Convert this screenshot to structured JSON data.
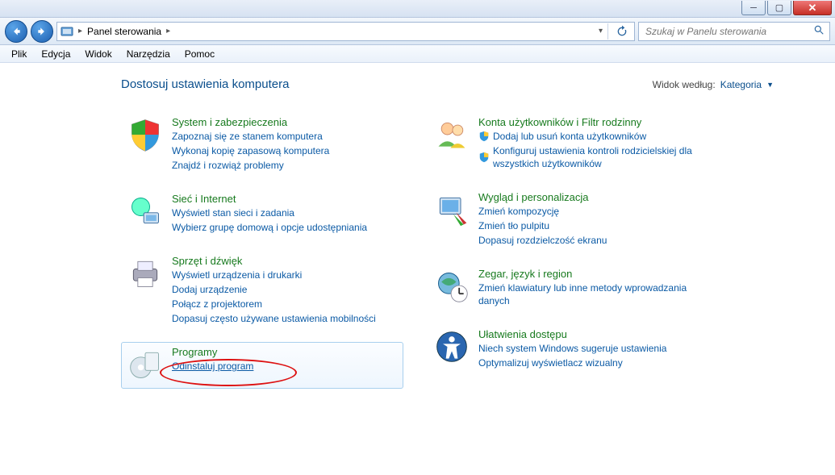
{
  "sysbuttons": {
    "min_tip": "Minimize",
    "max_tip": "Maximize",
    "close_tip": "Close"
  },
  "breadcrumb": {
    "root": "Panel sterowania"
  },
  "search": {
    "placeholder": "Szukaj w Panelu sterowania"
  },
  "menu": {
    "file": "Plik",
    "edit": "Edycja",
    "view": "Widok",
    "tools": "Narzędzia",
    "help": "Pomoc"
  },
  "header": {
    "title": "Dostosuj ustawienia komputera",
    "viewby_label": "Widok według:",
    "viewby_value": "Kategoria"
  },
  "cats": {
    "system": {
      "title": "System i zabezpieczenia",
      "l1": "Zapoznaj się ze stanem komputera",
      "l2": "Wykonaj kopię zapasową komputera",
      "l3": "Znajdź i rozwiąż problemy"
    },
    "network": {
      "title": "Sieć i Internet",
      "l1": "Wyświetl stan sieci i zadania",
      "l2": "Wybierz grupę domową i opcje udostępniania"
    },
    "hardware": {
      "title": "Sprzęt i dźwięk",
      "l1": "Wyświetl urządzenia i drukarki",
      "l2": "Dodaj urządzenie",
      "l3": "Połącz z projektorem",
      "l4": "Dopasuj często używane ustawienia mobilności"
    },
    "programs": {
      "title": "Programy",
      "l1": "Odinstaluj program"
    },
    "users": {
      "title": "Konta użytkowników i Filtr rodzinny",
      "l1": "Dodaj lub usuń konta użytkowników",
      "l2": "Konfiguruj ustawienia kontroli rodzicielskiej dla wszystkich użytkowników"
    },
    "appearance": {
      "title": "Wygląd i personalizacja",
      "l1": "Zmień kompozycję",
      "l2": "Zmień tło pulpitu",
      "l3": "Dopasuj rozdzielczość ekranu"
    },
    "clock": {
      "title": "Zegar, język i region",
      "l1": "Zmień klawiatury lub inne metody wprowadzania danych"
    },
    "ease": {
      "title": "Ułatwienia dostępu",
      "l1": "Niech system Windows sugeruje ustawienia",
      "l2": "Optymalizuj wyświetlacz wizualny"
    }
  }
}
